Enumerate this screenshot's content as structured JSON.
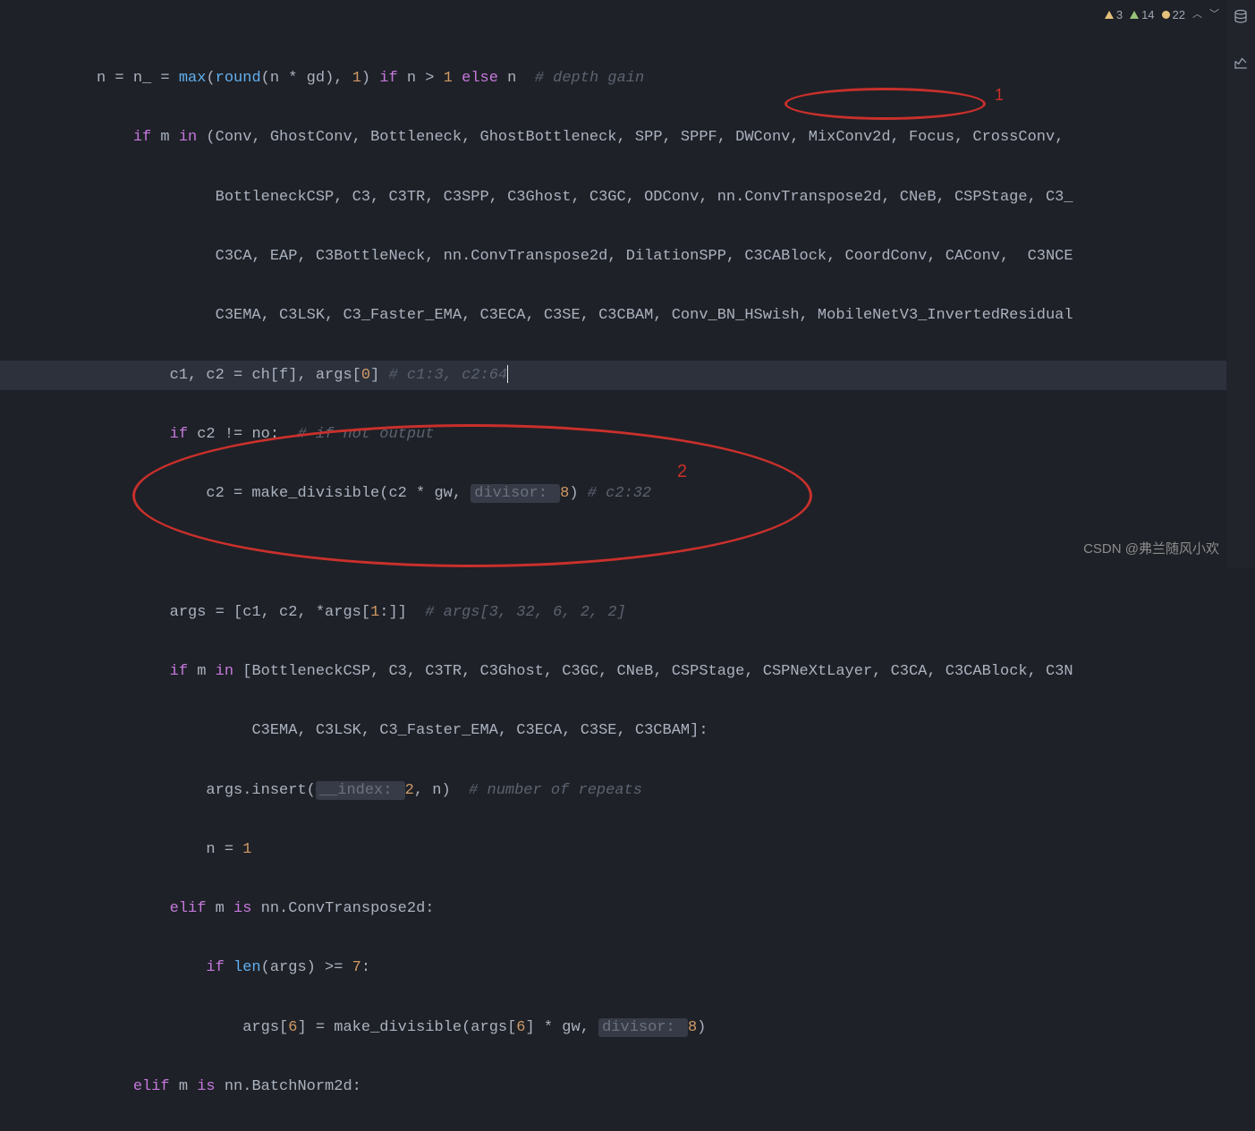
{
  "status": {
    "warn_yellow": "3",
    "warn_green": "14",
    "typo": "22"
  },
  "code": {
    "l1": {
      "a": "n",
      "b": " = ",
      "c": "n_",
      "d": " = ",
      "e": "max",
      "f": "(",
      "g": "round",
      "h": "(n * gd), ",
      "i": "1",
      "j": ") ",
      "k": "if",
      "l": " n > ",
      "m": "1",
      "n": " else",
      "o": " n  ",
      "p": "# depth gain"
    },
    "l2": {
      "a": "if",
      "b": " m ",
      "c": "in",
      "d": " (Conv, GhostConv, Bottleneck, GhostBottleneck, SPP, SPPF, DWConv, MixConv2d, Focus, CrossConv,"
    },
    "l3": {
      "a": "BottleneckCSP, C3, C3TR, C3SPP, C3Ghost, C3GC, ODConv, nn.ConvTranspose2d, CNeB, CSPStage, C3_"
    },
    "l4": {
      "a": "C3CA, EAP, C3BottleNeck, nn.ConvTranspose2d, DilationSPP, C3CABlock, CoordConv, CAConv,  C3NCE"
    },
    "l5": {
      "a": "C3EMA, C3LSK, C3_Faster_EMA, C3ECA, C3SE, C3CBAM, Conv_BN_HSwish, MobileNetV3_InvertedResidual"
    },
    "l6": {
      "a": "c1, c2 = ch[f], args[",
      "b": "0",
      "c": "] ",
      "d": "# c1:3, c2:64"
    },
    "l7": {
      "a": "if",
      "b": " c2 != no:  ",
      "c": "# if not output"
    },
    "l8": {
      "a": "c2 = make_divisible(c2 * gw, ",
      "b": "divisor: ",
      "c": "8",
      "d": ") ",
      "e": "# c2:32"
    },
    "l9": {
      "a": "args = [c1, c2, *args[",
      "b": "1",
      "c": ":]]  ",
      "d": "# args[3, 32, 6, 2, 2]"
    },
    "l10": {
      "a": "if",
      "b": " m ",
      "c": "in",
      "d": " [BottleneckCSP, C3, C3TR, C3Ghost, C3GC, CNeB, CSPStage, CSPNeXtLayer, C3CA, C3CABlock, C3N"
    },
    "l11": {
      "a": "C3EMA, C3LSK, C3_Faster_EMA, C3ECA, C3SE, C3CBAM]:"
    },
    "l12": {
      "a": "args.insert(",
      "b": "__index: ",
      "c": "2",
      "d": ", n)  ",
      "e": "# number of repeats"
    },
    "l13": {
      "a": "n = ",
      "b": "1"
    },
    "l14": {
      "a": "elif",
      "b": " m ",
      "c": "is",
      "d": " nn.ConvTranspose2d:"
    },
    "l15": {
      "a": "if",
      "b": " len",
      "c": "(args) >= ",
      "d": "7",
      "e": ":"
    },
    "l16": {
      "a": "args[",
      "b": "6",
      "c": "] = make_divisible(args[",
      "d": "6",
      "e": "] * gw, ",
      "f": "divisor: ",
      "g": "8",
      "h": ")"
    },
    "l17": {
      "a": "elif",
      "b": " m ",
      "c": "is",
      "d": " nn.BatchNorm2d:"
    }
  },
  "annotations": {
    "mark1": "1",
    "mark2": "2"
  },
  "watermark": "CSDN @弗兰随风小欢"
}
